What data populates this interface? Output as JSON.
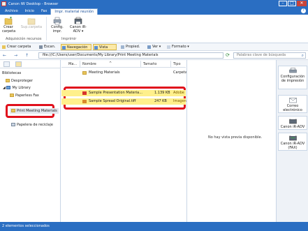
{
  "window": {
    "title": "Canon iW Desktop - Browser",
    "controls": {
      "minimize": "–",
      "maximize": "□",
      "close": "✕"
    }
  },
  "menu_tabs": [
    {
      "label": "Archivo"
    },
    {
      "label": "Inicio"
    },
    {
      "label": "Fax"
    },
    {
      "label": "Impr. material reunión"
    }
  ],
  "help": "?",
  "ribbon": {
    "buttons": [
      {
        "label": "Crear carpeta",
        "icon": "new-folder-icon"
      },
      {
        "label": "Sup.carpeta",
        "icon": "delete-folder-icon"
      },
      {
        "label": "Config. impr.",
        "icon": "print-settings-icon"
      },
      {
        "label": "Canon iR-ADV ▾",
        "icon": "printer-icon"
      }
    ],
    "groups": [
      {
        "label": "Adquisición recursos"
      },
      {
        "label": "Imprimir"
      }
    ]
  },
  "toolbar": {
    "create_folder": "Crear carpeta",
    "scan": "Escan.",
    "navigation": "Navegación",
    "preview": "Vista prelim.",
    "properties": "Propied.",
    "view": "Ver ▾",
    "format": "Formato ▾"
  },
  "address": {
    "back": "←",
    "forward": "→",
    "up": "↑",
    "path": "file:///C:/Users/user/Documents/My Library/Print Meeting Materials",
    "search_placeholder": "Palabras clave de búsqueda"
  },
  "tree": {
    "libraries": "Bibliotecas",
    "desktop": "Desproteger",
    "my_library": "My Library",
    "paperless_fax": "Paperless Fax",
    "print_meeting_materials": "Print Meeting Materials",
    "recycle_bin": "Papelera de reciclaje"
  },
  "columns": {
    "mark": "Ma...",
    "name": "Nombre",
    "size": "Tamaño",
    "type": "Tipo"
  },
  "files": [
    {
      "name": "Meeting Materials",
      "size": "",
      "type": "Carpeta",
      "icon": "folder-icon"
    },
    {
      "name": "Sample Presentation Materia...",
      "size": "1.139 KB",
      "type": "Adobe",
      "icon": "pdf-icon"
    },
    {
      "name": "Sample Spread Original.tiff",
      "size": "247 KB",
      "type": "Imagen",
      "icon": "image-icon"
    }
  ],
  "preview_message": "No hay vista previa disponible.",
  "right_pane": [
    {
      "label": "Configuración de impresión",
      "icon": "print-settings-icon"
    },
    {
      "label": "Correo electrónico",
      "icon": "email-icon"
    },
    {
      "label": "Canon iR-ADV",
      "icon": "printer-icon"
    },
    {
      "label": "Canon iR-ADV (FAX)",
      "icon": "fax-icon"
    }
  ],
  "status": "2 elementos seleccionados",
  "colors": {
    "accent": "#2a6ec2",
    "highlight": "#e0101c",
    "selection": "#fff08c"
  }
}
